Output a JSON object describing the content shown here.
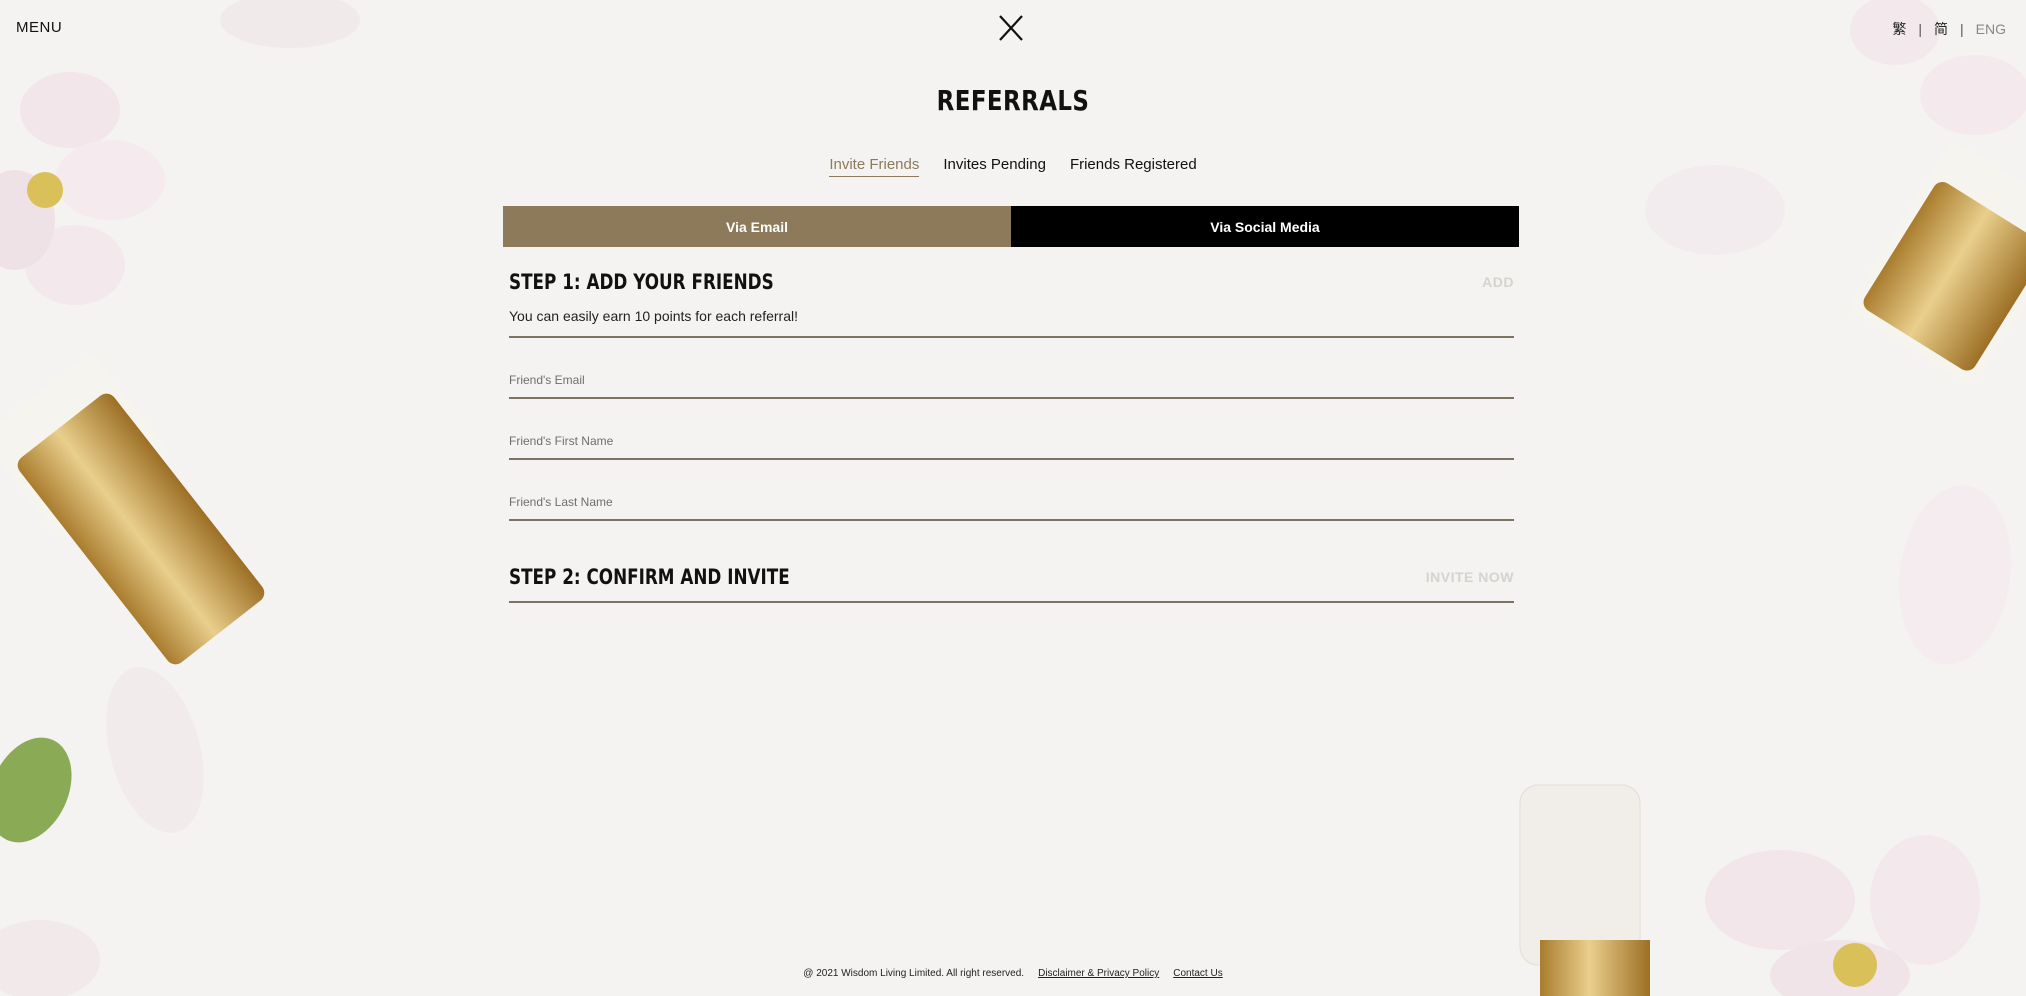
{
  "header": {
    "menu_label": "MENU",
    "languages": [
      "繁",
      "简",
      "ENG"
    ],
    "active_language": "ENG"
  },
  "page": {
    "title": "REFERRALS"
  },
  "tabs": [
    {
      "label": "Invite Friends",
      "active": true
    },
    {
      "label": "Invites Pending",
      "active": false
    },
    {
      "label": "Friends Registered",
      "active": false
    }
  ],
  "via": {
    "email_label": "Via Email",
    "social_label": "Via Social Media"
  },
  "step1": {
    "title": "STEP 1: ADD YOUR FRIENDS",
    "action": "ADD",
    "note": "You can easily earn 10 points for each referral!",
    "fields": [
      {
        "placeholder": "Friend's Email",
        "value": ""
      },
      {
        "placeholder": "Friend's First Name",
        "value": ""
      },
      {
        "placeholder": "Friend's Last Name",
        "value": ""
      }
    ]
  },
  "step2": {
    "title": "STEP 2: CONFIRM AND INVITE",
    "action": "INVITE NOW"
  },
  "footer": {
    "copyright": "@ 2021 Wisdom Living Limited. All right reserved.",
    "disclaimer_link": "Disclaimer & Privacy Policy",
    "contact_link": "Contact Us"
  },
  "colors": {
    "accent": "#8c7a5a",
    "social_button": "#000000",
    "background": "#f4f3f1",
    "muted_action": "#d6d3ce"
  }
}
